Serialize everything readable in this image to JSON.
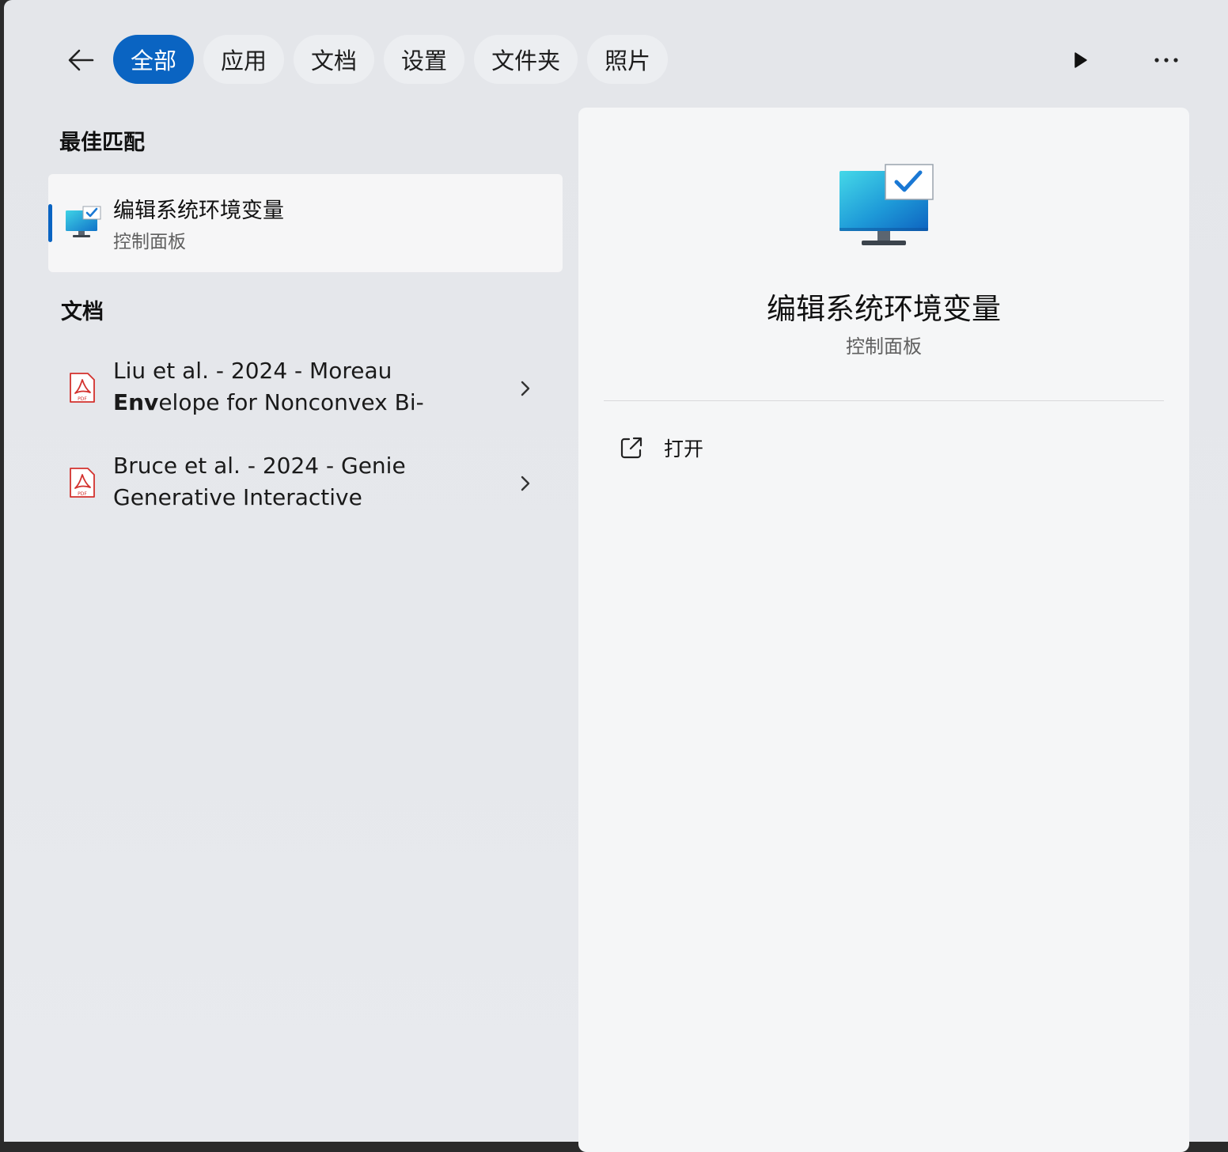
{
  "tabs": [
    {
      "label": "全部",
      "active": true
    },
    {
      "label": "应用",
      "active": false
    },
    {
      "label": "文档",
      "active": false
    },
    {
      "label": "设置",
      "active": false
    },
    {
      "label": "文件夹",
      "active": false
    },
    {
      "label": "照片",
      "active": false
    }
  ],
  "colors": {
    "accent": "#0a64c2",
    "pdf_red": "#d3312d"
  },
  "icons": {
    "back": "arrow-left-icon",
    "play": "play-icon",
    "more": "more-horizontal-icon",
    "app": "monitor-checkmark-icon",
    "pdf": "pdf-file-icon",
    "chevron": "chevron-right-icon",
    "open": "open-external-icon"
  },
  "best_match": {
    "heading": "最佳匹配",
    "name": "编辑系统环境变量",
    "subtitle": "控制面板"
  },
  "documents": {
    "heading": "文档",
    "items": [
      {
        "line1": "Liu et al. - 2024 - Moreau",
        "line2_bold": "Env",
        "line2_rest": "elope for Nonconvex Bi-"
      },
      {
        "line1": "Bruce et al. - 2024 - Genie",
        "line2_bold": "",
        "line2_rest": "Generative Interactive"
      }
    ]
  },
  "detail": {
    "title": "编辑系统环境变量",
    "subtitle": "控制面板",
    "actions": [
      {
        "label": "打开"
      }
    ]
  }
}
